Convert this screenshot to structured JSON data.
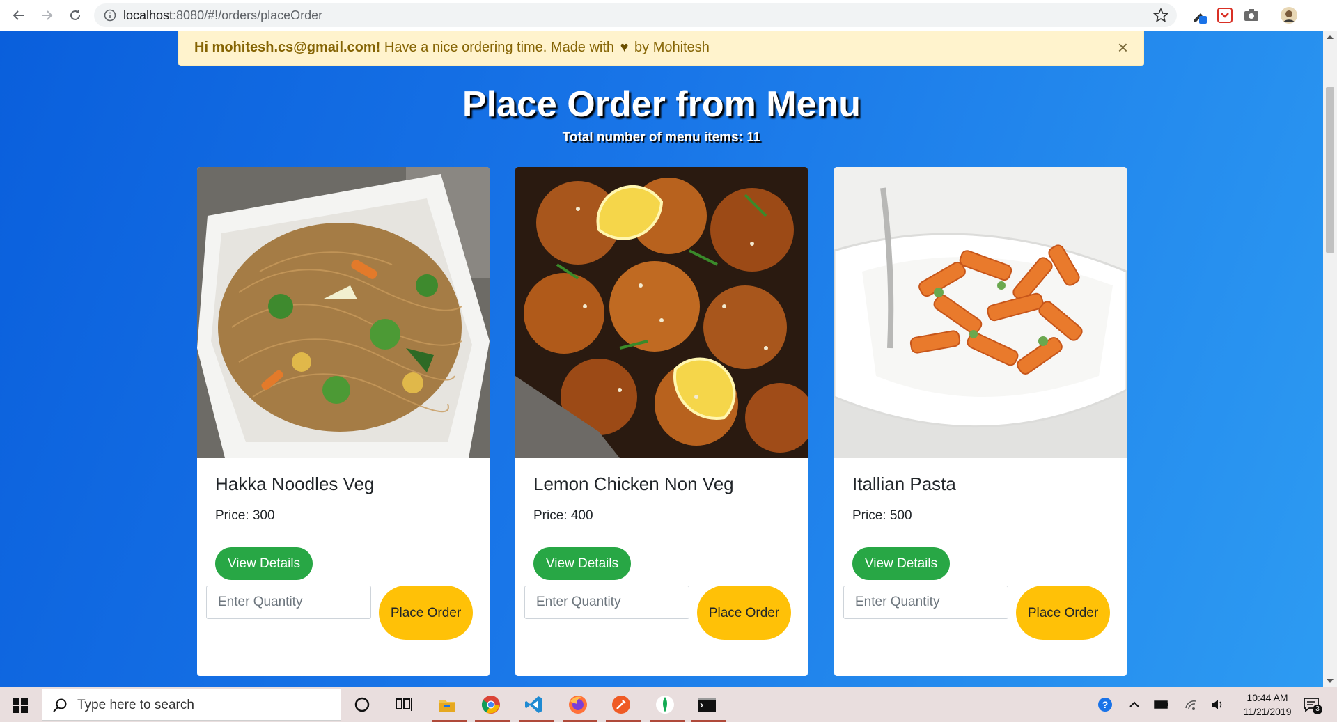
{
  "browser": {
    "url_host": "localhost",
    "url_rest": ":8080/#!/orders/placeOrder"
  },
  "alert": {
    "greeting": "Hi mohitesh.cs@gmail.com!",
    "message_before": " Have a nice ordering time. Made with",
    "heart": "♥",
    "message_after": " by Mohitesh",
    "close": "×"
  },
  "page": {
    "title": "Place Order from Menu",
    "subtitle": "Total number of menu items: 11"
  },
  "cards": [
    {
      "name": "Hakka Noodles Veg",
      "price": "Price: 300",
      "view_label": "View Details",
      "qty_placeholder": "Enter Quantity",
      "order_label": "Place Order",
      "image": "noodles"
    },
    {
      "name": "Lemon Chicken Non Veg",
      "price": "Price: 400",
      "view_label": "View Details",
      "qty_placeholder": "Enter Quantity",
      "order_label": "Place Order",
      "image": "chicken"
    },
    {
      "name": "Itallian Pasta",
      "price": "Price: 500",
      "view_label": "View Details",
      "qty_placeholder": "Enter Quantity",
      "order_label": "Place Order",
      "image": "pasta"
    }
  ],
  "taskbar": {
    "search_placeholder": "Type here to search",
    "time": "10:44 AM",
    "date": "11/21/2019",
    "notification_count": "3"
  },
  "colors": {
    "gradient_start": "#0a5fdc",
    "gradient_end": "#2d9bf2",
    "view_button": "#28a745",
    "order_button": "#ffc107",
    "alert_bg": "#fff3cd"
  }
}
